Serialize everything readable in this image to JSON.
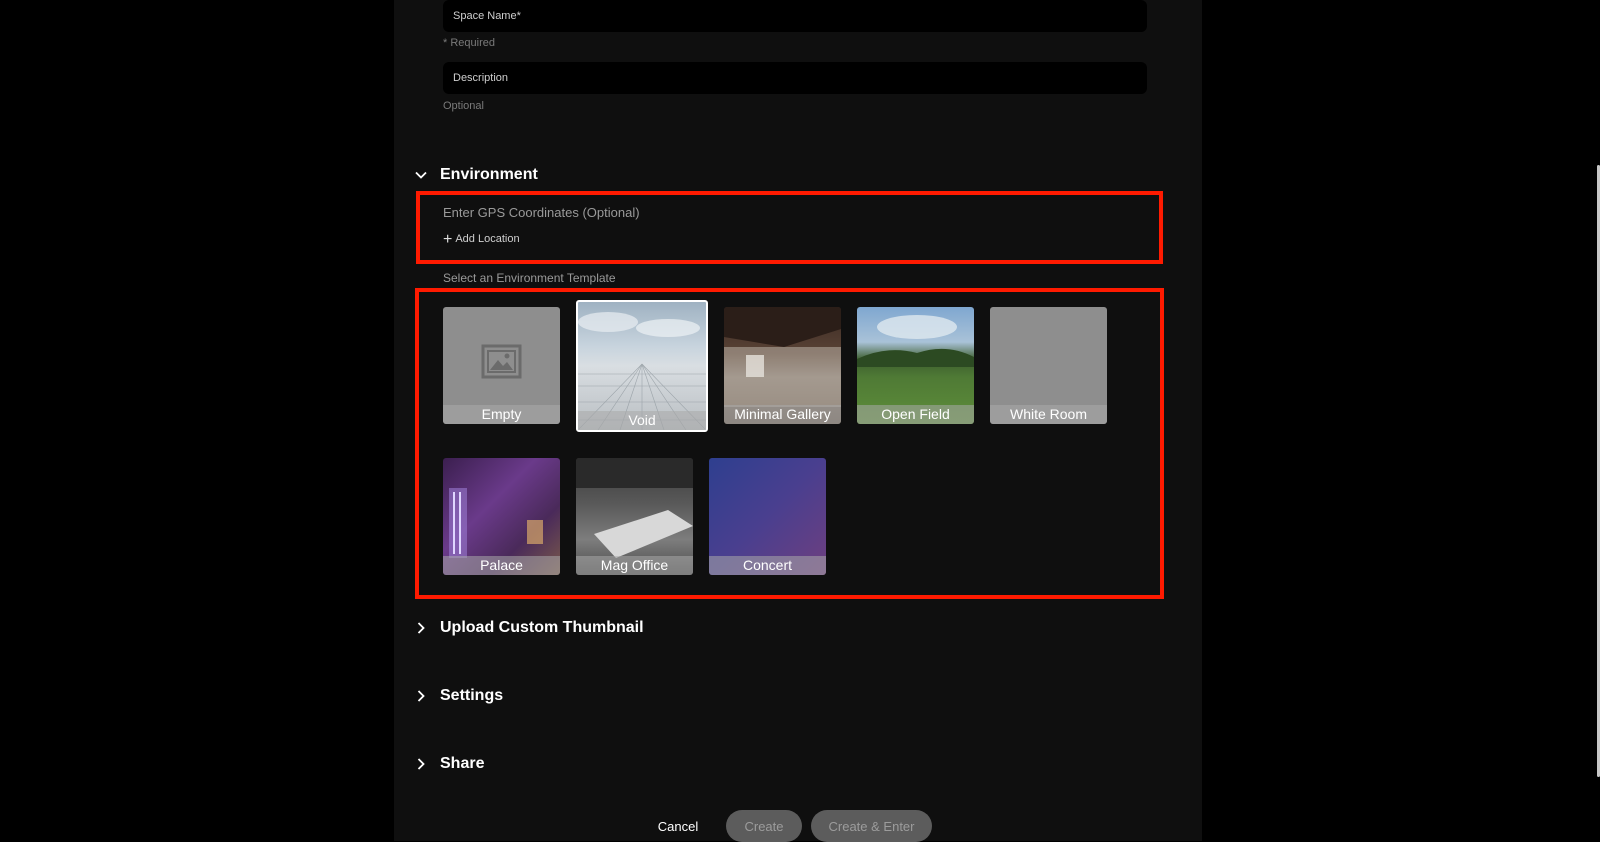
{
  "form": {
    "space_name_label": "Space Name*",
    "space_name_hint": "* Required",
    "description_label": "Description",
    "description_hint": "Optional"
  },
  "environment": {
    "title": "Environment",
    "gps_title": "Enter GPS Coordinates (Optional)",
    "add_location": "Add Location",
    "template_title": "Select an Environment Template",
    "templates": [
      {
        "label": "Empty"
      },
      {
        "label": "Void",
        "selected": true
      },
      {
        "label": "Minimal Gallery"
      },
      {
        "label": "Open Field"
      },
      {
        "label": "White Room"
      },
      {
        "label": "Palace"
      },
      {
        "label": "Mag Office"
      },
      {
        "label": "Concert"
      }
    ]
  },
  "sections": {
    "thumbnail": "Upload Custom Thumbnail",
    "settings": "Settings",
    "share": "Share"
  },
  "actions": {
    "cancel": "Cancel",
    "create": "Create",
    "create_enter": "Create & Enter"
  },
  "colors": {
    "highlight": "#ff1a00",
    "panel": "#0f0f0f"
  }
}
